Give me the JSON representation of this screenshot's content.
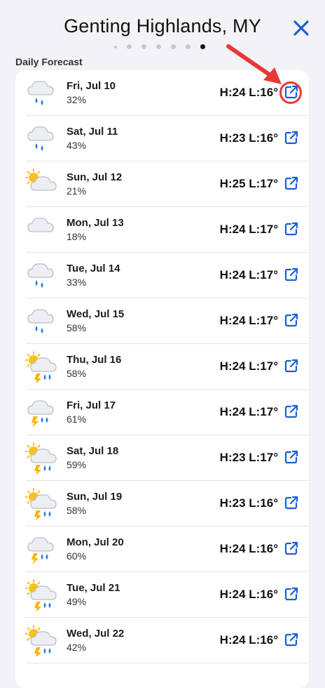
{
  "header": {
    "title": "Genting Highlands, MY"
  },
  "pager": {
    "count": 7,
    "active_index": 6
  },
  "section": {
    "label": "Daily Forecast"
  },
  "colors": {
    "accent": "#1a5fd6",
    "annotation": "#e53935"
  },
  "forecast": [
    {
      "day": "Fri, Jul 10",
      "precip": "32%",
      "temps": "H:24 L:16°",
      "icon": "cloud-rain-icon"
    },
    {
      "day": "Sat, Jul 11",
      "precip": "43%",
      "temps": "H:23 L:16°",
      "icon": "cloud-rain-icon"
    },
    {
      "day": "Sun, Jul 12",
      "precip": "21%",
      "temps": "H:25 L:17°",
      "icon": "sun-cloud-icon"
    },
    {
      "day": "Mon, Jul 13",
      "precip": "18%",
      "temps": "H:24 L:17°",
      "icon": "cloud-icon"
    },
    {
      "day": "Tue, Jul 14",
      "precip": "33%",
      "temps": "H:24 L:17°",
      "icon": "cloud-rain-icon"
    },
    {
      "day": "Wed, Jul 15",
      "precip": "58%",
      "temps": "H:24 L:17°",
      "icon": "cloud-rain-icon"
    },
    {
      "day": "Thu, Jul 16",
      "precip": "58%",
      "temps": "H:24 L:17°",
      "icon": "sun-cloud-storm-icon"
    },
    {
      "day": "Fri, Jul 17",
      "precip": "61%",
      "temps": "H:24 L:17°",
      "icon": "cloud-storm-icon"
    },
    {
      "day": "Sat, Jul 18",
      "precip": "59%",
      "temps": "H:23 L:17°",
      "icon": "sun-cloud-storm-icon"
    },
    {
      "day": "Sun, Jul 19",
      "precip": "58%",
      "temps": "H:23 L:16°",
      "icon": "sun-cloud-storm-icon"
    },
    {
      "day": "Mon, Jul 20",
      "precip": "60%",
      "temps": "H:24 L:16°",
      "icon": "cloud-storm-icon"
    },
    {
      "day": "Tue, Jul 21",
      "precip": "49%",
      "temps": "H:24 L:16°",
      "icon": "sun-cloud-storm-icon"
    },
    {
      "day": "Wed, Jul 22",
      "precip": "42%",
      "temps": "H:24 L:16°",
      "icon": "sun-cloud-storm-icon"
    }
  ]
}
